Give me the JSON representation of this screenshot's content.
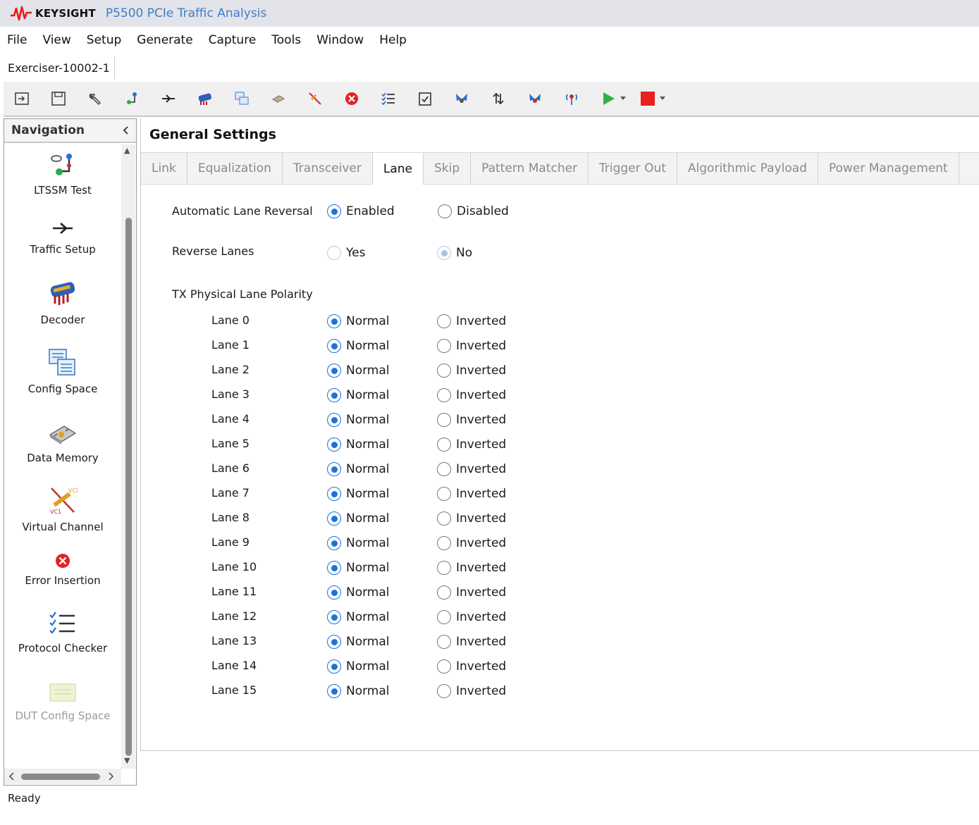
{
  "window": {
    "brand": "KEYSIGHT",
    "title": "P5500 PCIe Traffic Analysis",
    "brand_color": "#e0201c",
    "title_color": "#3d7fc6"
  },
  "menu": [
    "File",
    "View",
    "Setup",
    "Generate",
    "Capture",
    "Tools",
    "Window",
    "Help"
  ],
  "document_tab": "Exerciser-10002-1",
  "toolbar": [
    "open-icon",
    "save-icon",
    "wrench-icon",
    "ltssm-icon",
    "traffic-icon",
    "decoder-icon",
    "config-space-icon",
    "data-memory-icon",
    "virtual-channel-icon",
    "error-insertion-icon",
    "protocol-checker-icon",
    "checklist-icon",
    "butterfly-icon",
    "sort-arrows-icon",
    "capture-icon",
    "antenna-icon",
    "run-icon",
    "stop-icon"
  ],
  "navigation": {
    "title": "Navigation",
    "items": [
      {
        "label": "LTSSM Test",
        "icon": "ltssm-icon"
      },
      {
        "label": "Traffic Setup",
        "icon": "traffic-setup-icon"
      },
      {
        "label": "Decoder",
        "icon": "decoder-icon"
      },
      {
        "label": "Config Space",
        "icon": "config-space-icon"
      },
      {
        "label": "Data Memory",
        "icon": "data-memory-icon"
      },
      {
        "label": "Virtual Channel",
        "icon": "virtual-channel-icon"
      },
      {
        "label": "Error Insertion",
        "icon": "error-insertion-icon"
      },
      {
        "label": "Protocol Checker",
        "icon": "protocol-checker-icon"
      },
      {
        "label": "DUT Config Space",
        "icon": "dut-config-space-icon",
        "disabled": true
      }
    ]
  },
  "main": {
    "title": "General Settings",
    "tabs": [
      "Link",
      "Equalization",
      "Transceiver",
      "Lane",
      "Skip",
      "Pattern Matcher",
      "Trigger Out",
      "Algorithmic Payload",
      "Power Management"
    ],
    "active_tab": "Lane",
    "auto_lane_reversal": {
      "label": "Automatic Lane Reversal",
      "options": [
        "Enabled",
        "Disabled"
      ],
      "selected": "Enabled"
    },
    "reverse_lanes": {
      "label": "Reverse Lanes",
      "options": [
        "Yes",
        "No"
      ],
      "selected": "No"
    },
    "tx_polarity": {
      "label": "TX Physical Lane Polarity",
      "options": [
        "Normal",
        "Inverted"
      ],
      "lanes": [
        {
          "name": "Lane 0",
          "value": "Normal"
        },
        {
          "name": "Lane 1",
          "value": "Normal"
        },
        {
          "name": "Lane 2",
          "value": "Normal"
        },
        {
          "name": "Lane 3",
          "value": "Normal"
        },
        {
          "name": "Lane 4",
          "value": "Normal"
        },
        {
          "name": "Lane 5",
          "value": "Normal"
        },
        {
          "name": "Lane 6",
          "value": "Normal"
        },
        {
          "name": "Lane 7",
          "value": "Normal"
        },
        {
          "name": "Lane 8",
          "value": "Normal"
        },
        {
          "name": "Lane 9",
          "value": "Normal"
        },
        {
          "name": "Lane 10",
          "value": "Normal"
        },
        {
          "name": "Lane 11",
          "value": "Normal"
        },
        {
          "name": "Lane 12",
          "value": "Normal"
        },
        {
          "name": "Lane 13",
          "value": "Normal"
        },
        {
          "name": "Lane 14",
          "value": "Normal"
        },
        {
          "name": "Lane 15",
          "value": "Normal"
        }
      ]
    }
  },
  "status": "Ready"
}
